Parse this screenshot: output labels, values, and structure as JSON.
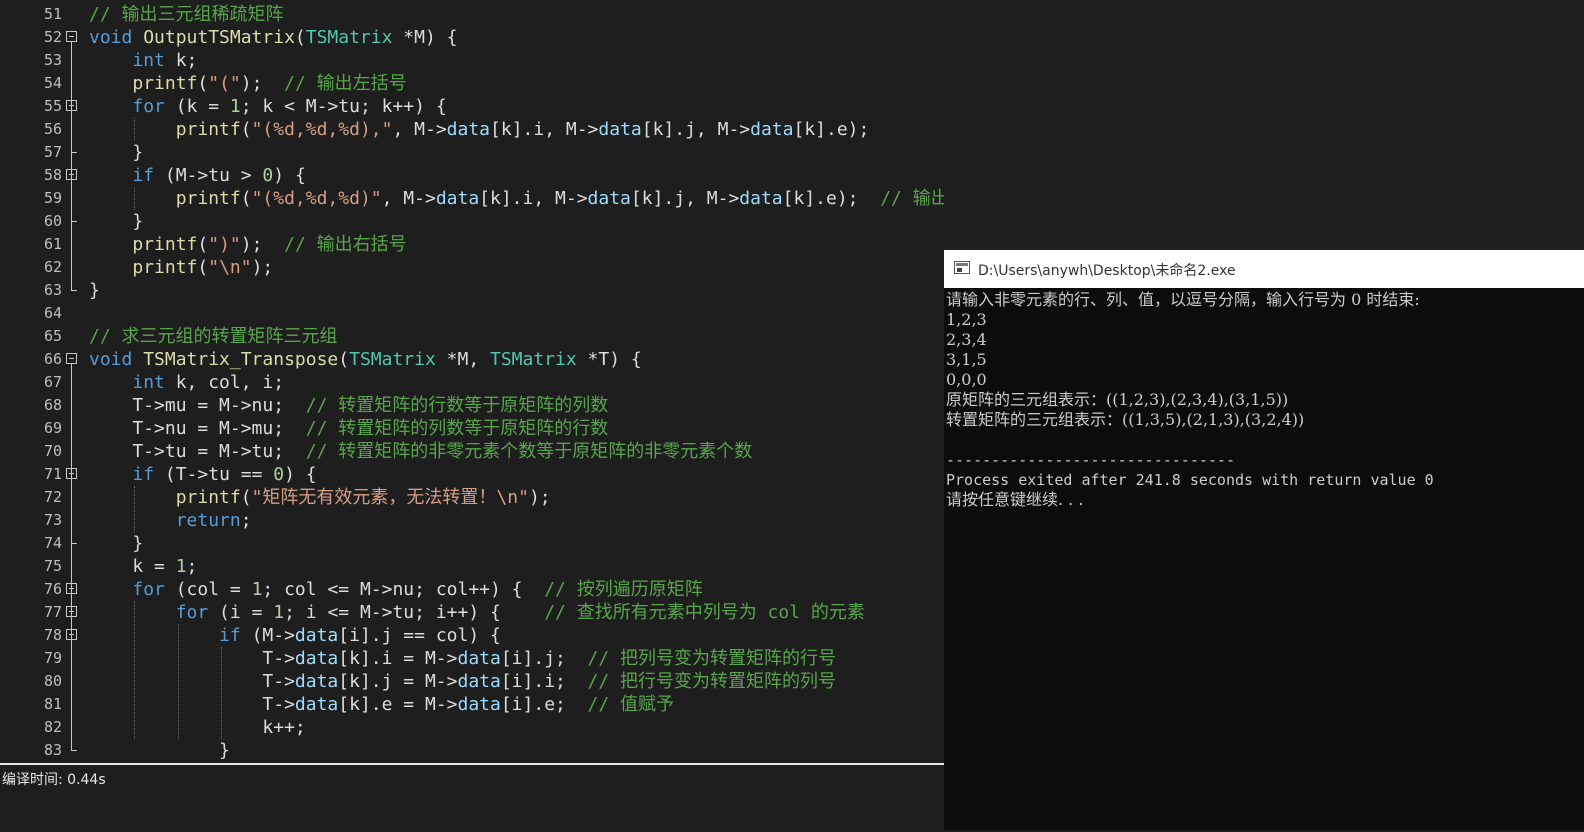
{
  "colors": {
    "keyword": "#569cd6",
    "function": "#dcdcaa",
    "type": "#4ec9b0",
    "comment": "#57a64a",
    "string": "#d69d85",
    "number": "#b5cea8",
    "identifier": "#9cdcfe",
    "plain": "#dcdcdc"
  },
  "editor": {
    "lines": [
      {
        "n": "51",
        "tokens": [
          {
            "t": "// 输出三元组稀疏矩阵",
            "c": "comment"
          }
        ]
      },
      {
        "n": "52",
        "tokens": [
          {
            "t": "void ",
            "c": "keyword"
          },
          {
            "t": "OutputTSMatrix",
            "c": "function"
          },
          {
            "t": "(",
            "c": "plain"
          },
          {
            "t": "TSMatrix",
            "c": "type"
          },
          {
            "t": " *M) {",
            "c": "plain"
          }
        ]
      },
      {
        "n": "53",
        "tokens": [
          {
            "t": "    ",
            "c": "plain"
          },
          {
            "t": "int",
            "c": "keyword"
          },
          {
            "t": " k;",
            "c": "plain"
          }
        ]
      },
      {
        "n": "54",
        "tokens": [
          {
            "t": "    ",
            "c": "plain"
          },
          {
            "t": "printf",
            "c": "function"
          },
          {
            "t": "(",
            "c": "plain"
          },
          {
            "t": "\"(\"",
            "c": "string"
          },
          {
            "t": ");  ",
            "c": "plain"
          },
          {
            "t": "// 输出左括号",
            "c": "comment"
          }
        ]
      },
      {
        "n": "55",
        "tokens": [
          {
            "t": "    ",
            "c": "plain"
          },
          {
            "t": "for",
            "c": "keyword"
          },
          {
            "t": " (k = ",
            "c": "plain"
          },
          {
            "t": "1",
            "c": "number"
          },
          {
            "t": "; k < M->tu; k++) {",
            "c": "plain"
          }
        ]
      },
      {
        "n": "56",
        "tokens": [
          {
            "t": "        ",
            "c": "plain"
          },
          {
            "t": "printf",
            "c": "function"
          },
          {
            "t": "(",
            "c": "plain"
          },
          {
            "t": "\"(%d,%d,%d),\"",
            "c": "string"
          },
          {
            "t": ", M->",
            "c": "plain"
          },
          {
            "t": "data",
            "c": "identifier"
          },
          {
            "t": "[k].i, M->",
            "c": "plain"
          },
          {
            "t": "data",
            "c": "identifier"
          },
          {
            "t": "[k].j, M->",
            "c": "plain"
          },
          {
            "t": "data",
            "c": "identifier"
          },
          {
            "t": "[k].e);",
            "c": "plain"
          }
        ]
      },
      {
        "n": "57",
        "tokens": [
          {
            "t": "    }",
            "c": "plain"
          }
        ]
      },
      {
        "n": "58",
        "tokens": [
          {
            "t": "    ",
            "c": "plain"
          },
          {
            "t": "if",
            "c": "keyword"
          },
          {
            "t": " (M->tu > ",
            "c": "plain"
          },
          {
            "t": "0",
            "c": "number"
          },
          {
            "t": ") {",
            "c": "plain"
          }
        ]
      },
      {
        "n": "59",
        "tokens": [
          {
            "t": "        ",
            "c": "plain"
          },
          {
            "t": "printf",
            "c": "function"
          },
          {
            "t": "(",
            "c": "plain"
          },
          {
            "t": "\"(%d,%d,%d)\"",
            "c": "string"
          },
          {
            "t": ", M->",
            "c": "plain"
          },
          {
            "t": "data",
            "c": "identifier"
          },
          {
            "t": "[k].i, M->",
            "c": "plain"
          },
          {
            "t": "data",
            "c": "identifier"
          },
          {
            "t": "[k].j, M->",
            "c": "plain"
          },
          {
            "t": "data",
            "c": "identifier"
          },
          {
            "t": "[k].e);  ",
            "c": "plain"
          },
          {
            "t": "// 输出最后一个元素，后面无逗号",
            "c": "comment"
          }
        ]
      },
      {
        "n": "60",
        "tokens": [
          {
            "t": "    }",
            "c": "plain"
          }
        ]
      },
      {
        "n": "61",
        "tokens": [
          {
            "t": "    ",
            "c": "plain"
          },
          {
            "t": "printf",
            "c": "function"
          },
          {
            "t": "(",
            "c": "plain"
          },
          {
            "t": "\")\"",
            "c": "string"
          },
          {
            "t": ");  ",
            "c": "plain"
          },
          {
            "t": "// 输出右括号",
            "c": "comment"
          }
        ]
      },
      {
        "n": "62",
        "tokens": [
          {
            "t": "    ",
            "c": "plain"
          },
          {
            "t": "printf",
            "c": "function"
          },
          {
            "t": "(",
            "c": "plain"
          },
          {
            "t": "\"\\n\"",
            "c": "string"
          },
          {
            "t": ");",
            "c": "plain"
          }
        ]
      },
      {
        "n": "63",
        "tokens": [
          {
            "t": "}",
            "c": "plain"
          }
        ]
      },
      {
        "n": "64",
        "tokens": []
      },
      {
        "n": "65",
        "tokens": [
          {
            "t": "// 求三元组的转置矩阵三元组",
            "c": "comment"
          }
        ]
      },
      {
        "n": "66",
        "tokens": [
          {
            "t": "void ",
            "c": "keyword"
          },
          {
            "t": "TSMatrix_Transpose",
            "c": "function"
          },
          {
            "t": "(",
            "c": "plain"
          },
          {
            "t": "TSMatrix",
            "c": "type"
          },
          {
            "t": " *M, ",
            "c": "plain"
          },
          {
            "t": "TSMatrix",
            "c": "type"
          },
          {
            "t": " *T) {",
            "c": "plain"
          }
        ]
      },
      {
        "n": "67",
        "tokens": [
          {
            "t": "    ",
            "c": "plain"
          },
          {
            "t": "int",
            "c": "keyword"
          },
          {
            "t": " k, col, i;",
            "c": "plain"
          }
        ]
      },
      {
        "n": "68",
        "tokens": [
          {
            "t": "    T->mu = M->nu;  ",
            "c": "plain"
          },
          {
            "t": "// 转置矩阵的行数等于原矩阵的列数",
            "c": "comment"
          }
        ]
      },
      {
        "n": "69",
        "tokens": [
          {
            "t": "    T->nu = M->mu;  ",
            "c": "plain"
          },
          {
            "t": "// 转置矩阵的列数等于原矩阵的行数",
            "c": "comment"
          }
        ]
      },
      {
        "n": "70",
        "tokens": [
          {
            "t": "    T->tu = M->tu;  ",
            "c": "plain"
          },
          {
            "t": "// 转置矩阵的非零元素个数等于原矩阵的非零元素个数",
            "c": "comment"
          }
        ]
      },
      {
        "n": "71",
        "tokens": [
          {
            "t": "    ",
            "c": "plain"
          },
          {
            "t": "if",
            "c": "keyword"
          },
          {
            "t": " (T->tu == ",
            "c": "plain"
          },
          {
            "t": "0",
            "c": "number"
          },
          {
            "t": ") {",
            "c": "plain"
          }
        ]
      },
      {
        "n": "72",
        "tokens": [
          {
            "t": "        ",
            "c": "plain"
          },
          {
            "t": "printf",
            "c": "function"
          },
          {
            "t": "(",
            "c": "plain"
          },
          {
            "t": "\"矩阵无有效元素，无法转置！\\n\"",
            "c": "string"
          },
          {
            "t": ");",
            "c": "plain"
          }
        ]
      },
      {
        "n": "73",
        "tokens": [
          {
            "t": "        ",
            "c": "plain"
          },
          {
            "t": "return",
            "c": "keyword"
          },
          {
            "t": ";",
            "c": "plain"
          }
        ]
      },
      {
        "n": "74",
        "tokens": [
          {
            "t": "    }",
            "c": "plain"
          }
        ]
      },
      {
        "n": "75",
        "tokens": [
          {
            "t": "    k = ",
            "c": "plain"
          },
          {
            "t": "1",
            "c": "number"
          },
          {
            "t": ";",
            "c": "plain"
          }
        ]
      },
      {
        "n": "76",
        "tokens": [
          {
            "t": "    ",
            "c": "plain"
          },
          {
            "t": "for",
            "c": "keyword"
          },
          {
            "t": " (col = ",
            "c": "plain"
          },
          {
            "t": "1",
            "c": "number"
          },
          {
            "t": "; col <= M->nu; col++) {  ",
            "c": "plain"
          },
          {
            "t": "// 按列遍历原矩阵",
            "c": "comment"
          }
        ]
      },
      {
        "n": "77",
        "tokens": [
          {
            "t": "        ",
            "c": "plain"
          },
          {
            "t": "for",
            "c": "keyword"
          },
          {
            "t": " (i = ",
            "c": "plain"
          },
          {
            "t": "1",
            "c": "number"
          },
          {
            "t": "; i <= M->tu; i++) {    ",
            "c": "plain"
          },
          {
            "t": "// 查找所有元素中列号为 col 的元素",
            "c": "comment"
          }
        ]
      },
      {
        "n": "78",
        "tokens": [
          {
            "t": "            ",
            "c": "plain"
          },
          {
            "t": "if",
            "c": "keyword"
          },
          {
            "t": " (M->",
            "c": "plain"
          },
          {
            "t": "data",
            "c": "identifier"
          },
          {
            "t": "[i].j == col) {",
            "c": "plain"
          }
        ]
      },
      {
        "n": "79",
        "tokens": [
          {
            "t": "                T->",
            "c": "plain"
          },
          {
            "t": "data",
            "c": "identifier"
          },
          {
            "t": "[k].i = M->",
            "c": "plain"
          },
          {
            "t": "data",
            "c": "identifier"
          },
          {
            "t": "[i].j;  ",
            "c": "plain"
          },
          {
            "t": "// 把列号变为转置矩阵的行号",
            "c": "comment"
          }
        ]
      },
      {
        "n": "80",
        "tokens": [
          {
            "t": "                T->",
            "c": "plain"
          },
          {
            "t": "data",
            "c": "identifier"
          },
          {
            "t": "[k].j = M->",
            "c": "plain"
          },
          {
            "t": "data",
            "c": "identifier"
          },
          {
            "t": "[i].i;  ",
            "c": "plain"
          },
          {
            "t": "// 把行号变为转置矩阵的列号",
            "c": "comment"
          }
        ]
      },
      {
        "n": "81",
        "tokens": [
          {
            "t": "                T->",
            "c": "plain"
          },
          {
            "t": "data",
            "c": "identifier"
          },
          {
            "t": "[k].e = M->",
            "c": "plain"
          },
          {
            "t": "data",
            "c": "identifier"
          },
          {
            "t": "[i].e;  ",
            "c": "plain"
          },
          {
            "t": "// 值赋予",
            "c": "comment"
          }
        ]
      },
      {
        "n": "82",
        "tokens": [
          {
            "t": "                k++;",
            "c": "plain"
          }
        ]
      },
      {
        "n": "83",
        "tokens": [
          {
            "t": "            }",
            "c": "plain"
          }
        ]
      }
    ]
  },
  "status_bar": {
    "compile_time": "编译时间: 0.44s"
  },
  "console": {
    "title": "D:\\Users\\anywh\\Desktop\\未命名2.exe",
    "lines": [
      "请输入非零元素的行、列、值，以逗号分隔，输入行号为 0 时结束:",
      "1,2,3",
      "2,3,4",
      "3,1,5",
      "0,0,0",
      "原矩阵的三元组表示：((1,2,3),(2,3,4),(3,1,5))",
      "转置矩阵的三元组表示：((1,3,5),(2,1,3),(3,2,4))",
      "",
      "--------------------------------",
      "Process exited after 241.8 seconds with return value 0",
      "请按任意键继续. . ."
    ]
  }
}
